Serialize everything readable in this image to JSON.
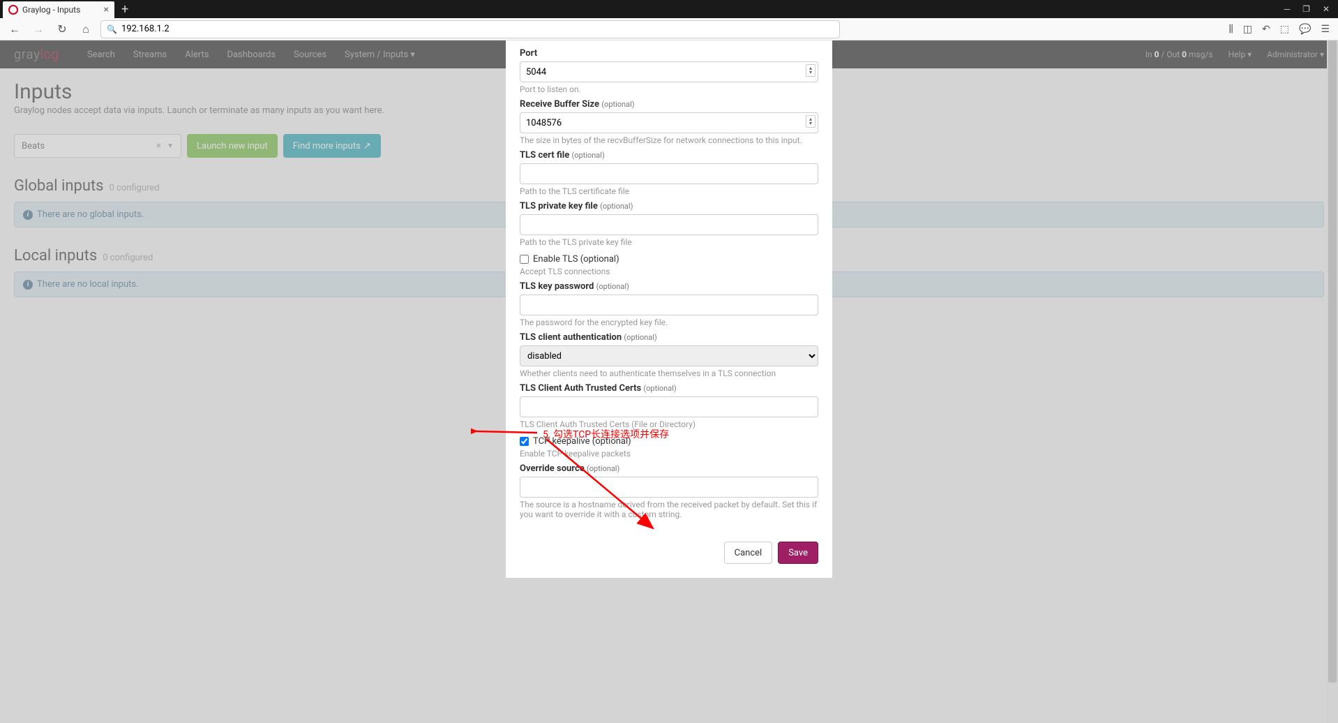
{
  "browser": {
    "tab_title": "Graylog - Inputs",
    "url": "192.168.1.2"
  },
  "nav": {
    "items": [
      "Search",
      "Streams",
      "Alerts",
      "Dashboards",
      "Sources",
      "System / Inputs"
    ],
    "status_prefix": "In ",
    "status_in": "0",
    "status_mid": " / Out ",
    "status_out": "0",
    "status_suffix": " msg/s",
    "help": "Help",
    "admin": "Administrator"
  },
  "page": {
    "title": "Inputs",
    "subtitle": "Graylog nodes accept data via inputs. Launch or terminate as many inputs as you want here.",
    "select_value": "Beats",
    "btn_launch": "Launch new input",
    "btn_find": "Find more inputs",
    "global_title": "Global inputs",
    "global_count": "0 configured",
    "global_info": "There are no global inputs.",
    "local_title": "Local inputs",
    "local_count": "0 configured",
    "local_info": "There are no local inputs."
  },
  "modal": {
    "optional": "(optional)",
    "port_label": "Port",
    "port_value": "5044",
    "port_help": "Port to listen on.",
    "recv_label": "Receive Buffer Size",
    "recv_value": "1048576",
    "recv_help": "The size in bytes of the recvBufferSize for network connections to this input.",
    "cert_label": "TLS cert file",
    "cert_help": "Path to the TLS certificate file",
    "pkey_label": "TLS private key file",
    "pkey_help": "Path to the TLS private key file",
    "enable_tls": "Enable TLS",
    "enable_tls_help": "Accept TLS connections",
    "keypass_label": "TLS key password",
    "keypass_help": "The password for the encrypted key file.",
    "auth_label": "TLS client authentication",
    "auth_value": "disabled",
    "auth_help": "Whether clients need to authenticate themselves in a TLS connection",
    "trusted_label": "TLS Client Auth Trusted Certs",
    "trusted_help": "TLS Client Auth Trusted Certs (File or Directory)",
    "keepalive": "TCP keepalive",
    "keepalive_help": "Enable TCP keepalive packets",
    "override_label": "Override source",
    "override_help": "The source is a hostname derived from the received packet by default. Set this if you want to override it with a custom string.",
    "cancel": "Cancel",
    "save": "Save"
  },
  "annotation": "5. 勾选TCP长连接选项并保存"
}
